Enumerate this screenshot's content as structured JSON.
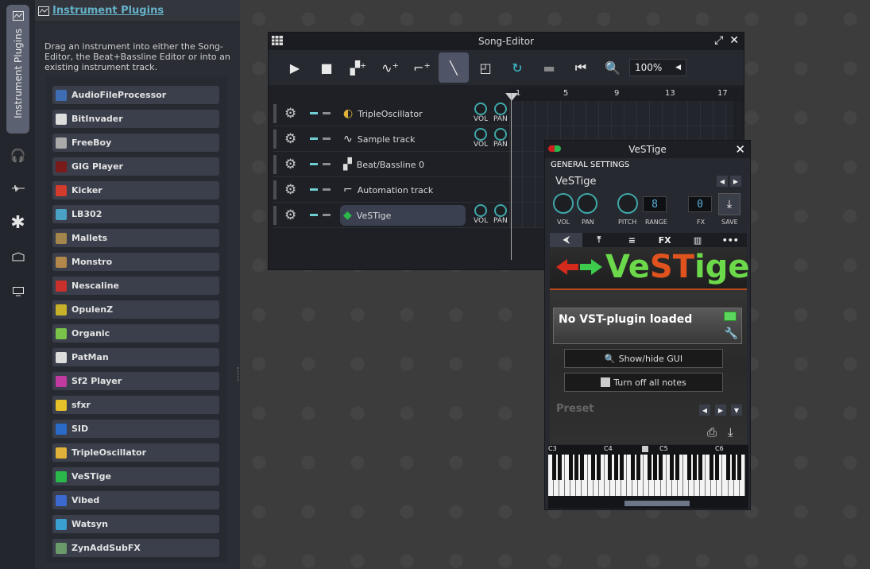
{
  "sidebar": {
    "tabs": [
      {
        "label": "Instrument Plugins",
        "icon": "instrument-icon"
      },
      {
        "icon": "headphones-icon"
      },
      {
        "icon": "waveform-icon"
      },
      {
        "icon": "star-icon"
      },
      {
        "icon": "home-icon"
      },
      {
        "icon": "computer-icon"
      }
    ]
  },
  "plugin_panel": {
    "title": "Instrument Plugins",
    "description": "Drag an instrument into either the Song-Editor, the Beat+Bassline Editor or into an existing instrument track.",
    "plugins": [
      {
        "name": "AudioFileProcessor",
        "color": "#3f6db3"
      },
      {
        "name": "BitInvader",
        "color": "#dddddd"
      },
      {
        "name": "FreeBoy",
        "color": "#aaaaaa"
      },
      {
        "name": "GIG Player",
        "color": "#7a1a1a"
      },
      {
        "name": "Kicker",
        "color": "#d33b2c"
      },
      {
        "name": "LB302",
        "color": "#4aa3c4"
      },
      {
        "name": "Mallets",
        "color": "#a4864d"
      },
      {
        "name": "Monstro",
        "color": "#b3874a"
      },
      {
        "name": "Nescaline",
        "color": "#c9302c"
      },
      {
        "name": "OpulenZ",
        "color": "#c8b12a"
      },
      {
        "name": "Organic",
        "color": "#7ac24a"
      },
      {
        "name": "PatMan",
        "color": "#dddddd"
      },
      {
        "name": "Sf2 Player",
        "color": "#c03aa0"
      },
      {
        "name": "sfxr",
        "color": "#e6c12a"
      },
      {
        "name": "SID",
        "color": "#2a6ac8"
      },
      {
        "name": "TripleOscillator",
        "color": "#e0b23a"
      },
      {
        "name": "VeSTige",
        "color": "#2ab84a"
      },
      {
        "name": "Vibed",
        "color": "#3a6ad0"
      },
      {
        "name": "Watsyn",
        "color": "#3aa0d0"
      },
      {
        "name": "ZynAddSubFX",
        "color": "#6a9a6a"
      }
    ]
  },
  "song_editor": {
    "title": "Song-Editor",
    "zoom": "100%",
    "timeline": [
      "1",
      "5",
      "9",
      "13",
      "17"
    ],
    "tracks": [
      {
        "name": "TripleOscillator",
        "knobs": true
      },
      {
        "name": "Sample track",
        "knobs": true
      },
      {
        "name": "Beat/Bassline 0",
        "knobs": false
      },
      {
        "name": "Automation track",
        "knobs": false
      },
      {
        "name": "VeSTige",
        "knobs": true
      }
    ],
    "knob_labels": {
      "vol": "VOL",
      "pan": "PAN"
    }
  },
  "vestige": {
    "title": "VeSTige",
    "section": "GENERAL SETTINGS",
    "name": "VeSTige",
    "labels": {
      "vol": "VOL",
      "pan": "PAN",
      "pitch": "PITCH",
      "range": "RANGE",
      "fx": "FX",
      "save": "SAVE"
    },
    "range_lcd": "8",
    "fx_lcd": "0",
    "tabs": [
      "⮜",
      "⤒",
      "≡",
      "FX",
      "▥",
      "•••"
    ],
    "logo_text": "VeSTige",
    "status": "No VST-plugin loaded",
    "show_hide_gui": "Show/hide GUI",
    "turn_off_notes": "Turn off all notes",
    "preset_label": "Preset",
    "keyboard_labels": [
      "C3",
      "C4",
      "C5",
      "C6"
    ]
  }
}
